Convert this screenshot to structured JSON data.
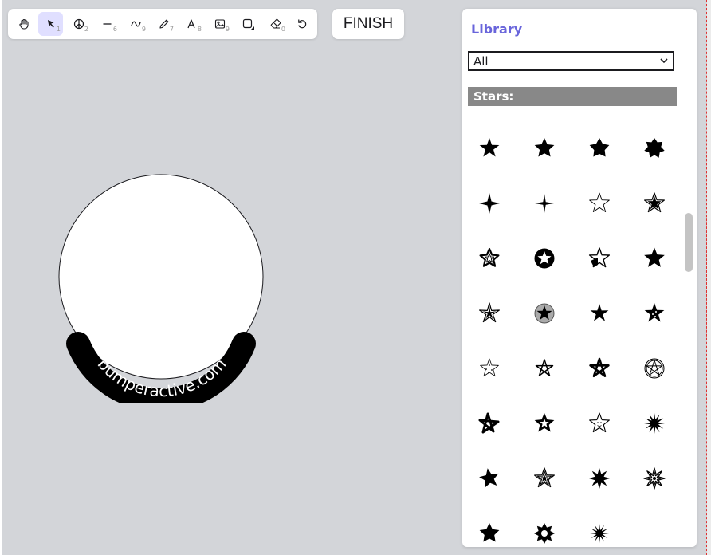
{
  "toolbar": {
    "tools": [
      {
        "name": "hand-tool",
        "icon": "hand-icon",
        "shortcut": ""
      },
      {
        "name": "selection-tool",
        "icon": "arrow-icon",
        "shortcut": "1",
        "active": true
      },
      {
        "name": "peace-tool",
        "icon": "peace-icon",
        "shortcut": "2"
      },
      {
        "name": "line-tool",
        "icon": "line-icon",
        "shortcut": "6"
      },
      {
        "name": "curve-tool",
        "icon": "curve-icon",
        "shortcut": "9"
      },
      {
        "name": "draw-tool",
        "icon": "pencil-icon",
        "shortcut": "7"
      },
      {
        "name": "text-tool",
        "icon": "text-icon",
        "shortcut": "8"
      },
      {
        "name": "image-tool",
        "icon": "image-icon",
        "shortcut": "9"
      },
      {
        "name": "shape-tool",
        "icon": "rectangle-icon",
        "shortcut": ""
      },
      {
        "name": "eraser-tool",
        "icon": "eraser-icon",
        "shortcut": "0"
      },
      {
        "name": "reset-tool",
        "icon": "reset-icon",
        "shortcut": ""
      }
    ]
  },
  "finish_label": "FINISH",
  "canvas": {
    "badge_text": "bumperactive.com"
  },
  "library": {
    "title": "Library",
    "filter_value": "All",
    "section_title": "Stars:",
    "accent_color": "#6965db"
  }
}
